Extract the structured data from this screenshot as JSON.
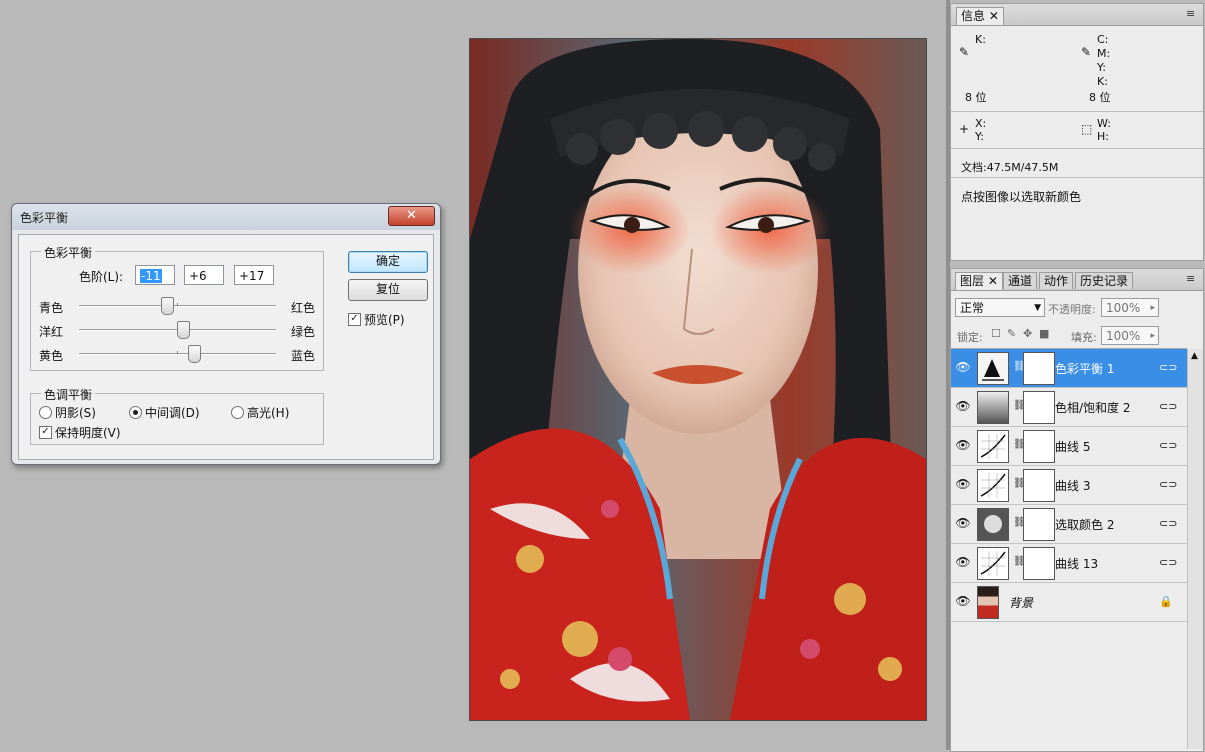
{
  "dialog": {
    "title": "色彩平衡",
    "close_label": "✕",
    "color_balance_group": "色彩平衡",
    "levels_label": "色阶(L):",
    "levels": [
      "-11",
      "+6",
      "+17"
    ],
    "sliders": [
      {
        "left": "青色",
        "right": "红色",
        "value": -11
      },
      {
        "left": "洋红",
        "right": "绿色",
        "value": 6
      },
      {
        "left": "黄色",
        "right": "蓝色",
        "value": 17
      }
    ],
    "ok_label": "确定",
    "reset_label": "复位",
    "preview_label": "预览(P)",
    "preview_checked": true,
    "tone_group": "色调平衡",
    "tone_options": [
      "阴影(S)",
      "中间调(D)",
      "高光(H)"
    ],
    "tone_selected": "中间调(D)",
    "preserve_luminosity_label": "保持明度(V)",
    "preserve_luminosity_checked": true
  },
  "info_panel": {
    "tab": "信息",
    "k_label": "K:",
    "c_label": "C:",
    "m_label": "M:",
    "y_label": "Y:",
    "k2_label": "K:",
    "bits_left": "8 位",
    "bits_right": "8 位",
    "x_label": "X:",
    "y2_label": "Y:",
    "w_label": "W:",
    "h_label": "H:",
    "doc_size": "文档:47.5M/47.5M",
    "hint": "点按图像以选取新颜色"
  },
  "layers_panel": {
    "tabs": [
      "图层",
      "通道",
      "动作",
      "历史记录"
    ],
    "blend_mode": "正常",
    "opacity_label": "不透明度:",
    "opacity_value": "100%",
    "lock_label": "锁定:",
    "fill_label": "填充:",
    "fill_value": "100%",
    "layers": [
      {
        "name": "色彩平衡 1",
        "icon": "color-balance-icon",
        "active": true
      },
      {
        "name": "色相/饱和度 2",
        "icon": "hue-saturation-icon",
        "active": false
      },
      {
        "name": "曲线 5",
        "icon": "curves-icon",
        "active": false
      },
      {
        "name": "曲线 3",
        "icon": "curves-icon",
        "active": false
      },
      {
        "name": "选取颜色 2",
        "icon": "selective-color-icon",
        "active": false
      },
      {
        "name": "曲线 13",
        "icon": "curves-icon",
        "active": false
      },
      {
        "name": "背景",
        "icon": "photo-thumbnail",
        "active": false
      }
    ]
  },
  "colors": {
    "active_layer": "#3a8ee6",
    "costume_red": "#c8231c",
    "selection": "#3399ff"
  }
}
